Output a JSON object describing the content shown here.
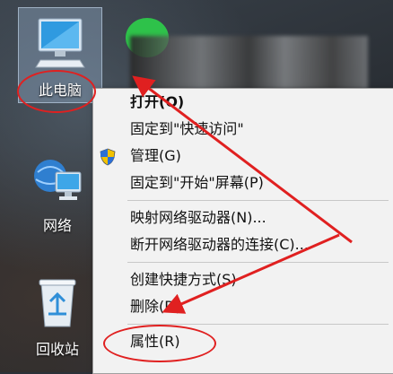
{
  "desktop": {
    "icons": [
      {
        "label": "此电脑",
        "icon": "computer-icon"
      },
      {
        "label": "网络",
        "icon": "network-icon"
      },
      {
        "label": "回收站",
        "icon": "recycle-bin-icon"
      }
    ]
  },
  "context_menu": {
    "items": [
      {
        "label": "打开(O)",
        "bold": true
      },
      {
        "label": "固定到\"快速访问\""
      },
      {
        "label": "管理(G)",
        "icon": "shield-icon"
      },
      {
        "label": "固定到\"开始\"屏幕(P)"
      },
      {
        "label": "映射网络驱动器(N)..."
      },
      {
        "label": "断开网络驱动器的连接(C)..."
      },
      {
        "label": "创建快捷方式(S)"
      },
      {
        "label": "删除(D)"
      },
      {
        "label": "属性(R)"
      }
    ]
  },
  "annotation_color": "#e02020"
}
